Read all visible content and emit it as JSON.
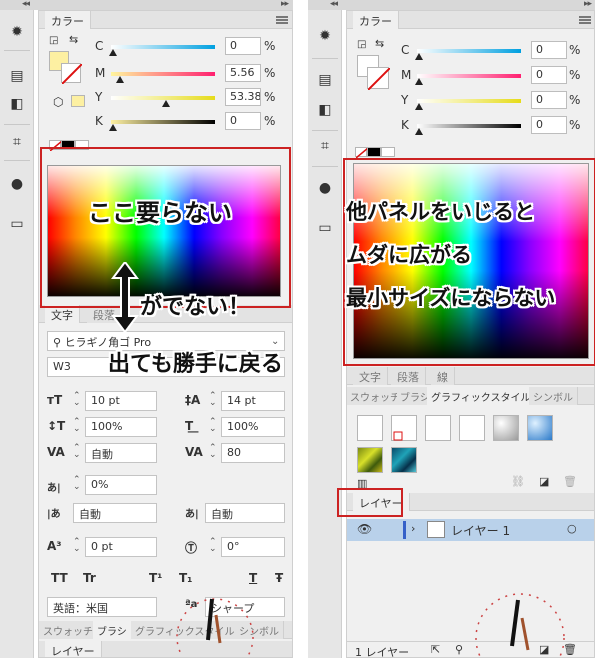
{
  "left_panel": {
    "color_tab": "カラー",
    "sliders": [
      {
        "label": "C",
        "value": "0",
        "unit": "%",
        "fill": 0.0
      },
      {
        "label": "M",
        "value": "5.56",
        "unit": "%",
        "fill": 0.06
      },
      {
        "label": "Y",
        "value": "53.38",
        "unit": "%",
        "fill": 0.53
      },
      {
        "label": "K",
        "value": "0",
        "unit": "%",
        "fill": 0.0
      }
    ],
    "annotation_1": "ここ要らない",
    "annotation_2": "がでない！",
    "annotation_3": "出ても勝手に戻る",
    "type_tabs": [
      "文字",
      "段落"
    ],
    "font_family": "ヒラギノ角ゴ Pro",
    "font_style": "W3",
    "font_size": "10 pt",
    "leading": "14 pt",
    "vertical_scale": "100%",
    "horizontal_scale": "100%",
    "kerning": "自動",
    "tracking": "80",
    "tsume": "0%",
    "aki_left": "自動",
    "aki_right": "自動",
    "baseline_shift": "0 pt",
    "rotation": "0°",
    "style_buttons": [
      "TT",
      "Tr",
      "T¹",
      "T₁",
      "T",
      "Ŧ"
    ],
    "language": "英語：米国",
    "antialias": "シャープ",
    "bottom_tabs": [
      "スウォッチ",
      "ブラシ",
      "グラフィックスタイル",
      "シンボル"
    ],
    "layers_tab": "レイヤー"
  },
  "right_panel": {
    "color_tab": "カラー",
    "sliders": [
      {
        "label": "C",
        "value": "0",
        "unit": "%",
        "fill": 0.0
      },
      {
        "label": "M",
        "value": "0",
        "unit": "%",
        "fill": 0.0
      },
      {
        "label": "Y",
        "value": "0",
        "unit": "%",
        "fill": 0.0
      },
      {
        "label": "K",
        "value": "0",
        "unit": "%",
        "fill": 0.0
      }
    ],
    "annotation_1": "他パネルをいじると",
    "annotation_2": "ムダに広がる",
    "annotation_3": "最小サイズにならない",
    "type_tabs": [
      "文字",
      "段落",
      "線"
    ],
    "graphic_tabs": [
      "スウォッチ",
      "ブラシ",
      "グラフィックスタイル",
      "シンボル"
    ],
    "layers_tab": "レイヤー",
    "layer_name": "レイヤー 1",
    "layer_count": "1 レイヤー"
  },
  "colors": {
    "accent_red": "#cc2222",
    "panel_bg": "#f0f0f0",
    "layer_selected": "#b9d1ea"
  }
}
